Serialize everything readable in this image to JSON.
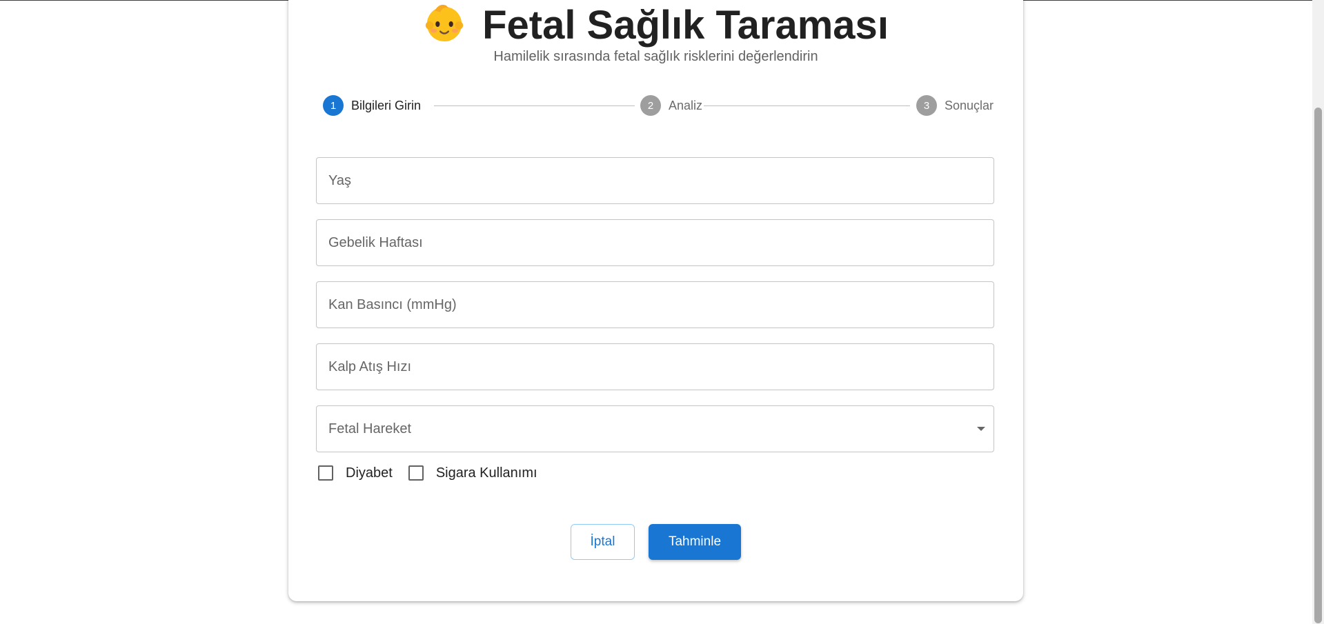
{
  "header": {
    "emoji_icon": "baby-face-icon",
    "title": "Fetal Sağlık Taraması",
    "subtitle": "Hamilelik sırasında fetal sağlık risklerini değerlendirin"
  },
  "stepper": {
    "steps": [
      {
        "number": "1",
        "label": "Bilgileri Girin",
        "state": "active"
      },
      {
        "number": "2",
        "label": "Analiz",
        "state": "inactive"
      },
      {
        "number": "3",
        "label": "Sonuçlar",
        "state": "inactive"
      }
    ]
  },
  "form": {
    "age": {
      "placeholder": "Yaş",
      "value": ""
    },
    "pregnancy_week": {
      "placeholder": "Gebelik Haftası",
      "value": ""
    },
    "blood_pressure": {
      "placeholder": "Kan Basıncı (mmHg)",
      "value": ""
    },
    "heart_rate": {
      "placeholder": "Kalp Atış Hızı",
      "value": ""
    },
    "fetal_movement": {
      "label": "Fetal Hareket",
      "selected": ""
    },
    "checkboxes": {
      "diabetes": {
        "label": "Diyabet",
        "checked": false
      },
      "smoking": {
        "label": "Sigara Kullanımı",
        "checked": false
      }
    }
  },
  "actions": {
    "cancel_label": "İptal",
    "predict_label": "Tahminle"
  },
  "colors": {
    "primary": "#1976d2",
    "inactive_step": "#9e9e9e",
    "border": "#c4c4c4"
  }
}
